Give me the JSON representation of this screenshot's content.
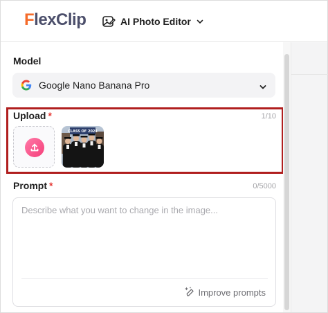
{
  "header": {
    "logo_prefix": "F",
    "logo_text_fx": "lex",
    "logo_text_clip": "Clip",
    "tool_name": "AI Photo Editor",
    "tool_icon": "image-edit-icon",
    "dropdown_icon": "chevron-down-icon"
  },
  "model": {
    "label": "Model",
    "selected": "Google Nano Banana Pro",
    "provider_icon": "google-g-icon"
  },
  "upload": {
    "label": "Upload",
    "required_mark": "*",
    "counter": "1/10",
    "upload_icon": "upload-arrow-icon",
    "thumbnail_icon": "photo-thumbnail",
    "banner_text": "CLASS OF 2024"
  },
  "prompt": {
    "label": "Prompt",
    "required_mark": "*",
    "counter": "0/5000",
    "placeholder": "Describe what you want to change in the image...",
    "value": "",
    "improve_label": "Improve prompts",
    "improve_icon": "sparkle-pen-icon"
  },
  "colors": {
    "brand_orange": "#f56b2a",
    "brand_dark": "#4c4f6b",
    "required_red": "#e53935",
    "highlight_border": "#b01e1e",
    "upload_pink": "#f53f7a"
  }
}
